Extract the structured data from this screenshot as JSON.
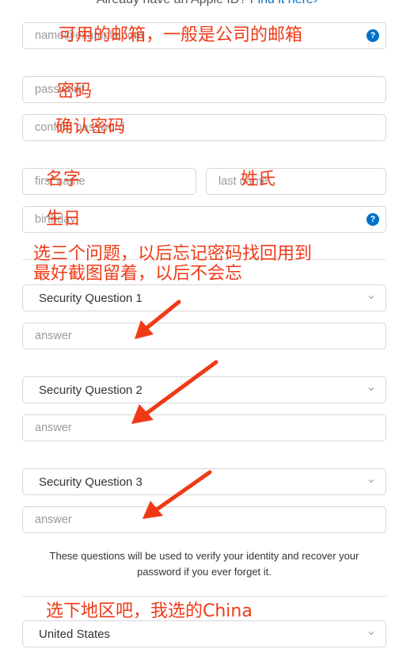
{
  "header": {
    "existing_id_text": "Already have an Apple ID?",
    "find_link": "Find it here",
    "find_link_arrow": "›"
  },
  "form": {
    "email_placeholder": "name@example.com",
    "password_placeholder": "password",
    "confirm_placeholder": "confirm password",
    "first_name_placeholder": "first name",
    "last_name_placeholder": "last name",
    "birthday_placeholder": "birthday",
    "help_icon": "?",
    "questions": [
      {
        "label": "Security Question 1",
        "answer_placeholder": "answer"
      },
      {
        "label": "Security Question 2",
        "answer_placeholder": "answer"
      },
      {
        "label": "Security Question 3",
        "answer_placeholder": "answer"
      }
    ],
    "questions_note": "These questions will be used to verify your identity and recover your password if you ever forget it.",
    "country": "United States"
  },
  "annotations": {
    "email": "可用的邮箱，一般是公司的邮箱",
    "password": "密码",
    "confirm": "确认密码",
    "first_name": "名字",
    "last_name": "姓氏",
    "birthday": "生日",
    "questions_line1": "选三个问题，以后忘记密码找回用到",
    "questions_line2": "最好截图留着，以后不会忘",
    "country": "选下地区吧，我选的China"
  },
  "colors": {
    "annotation": "#f03a17",
    "link": "#0070c9",
    "border": "#d6d6d6"
  },
  "icons": {
    "help": "help-icon",
    "chevron": "chevron-down-icon",
    "arrow": "arrow-annotation-icon"
  }
}
